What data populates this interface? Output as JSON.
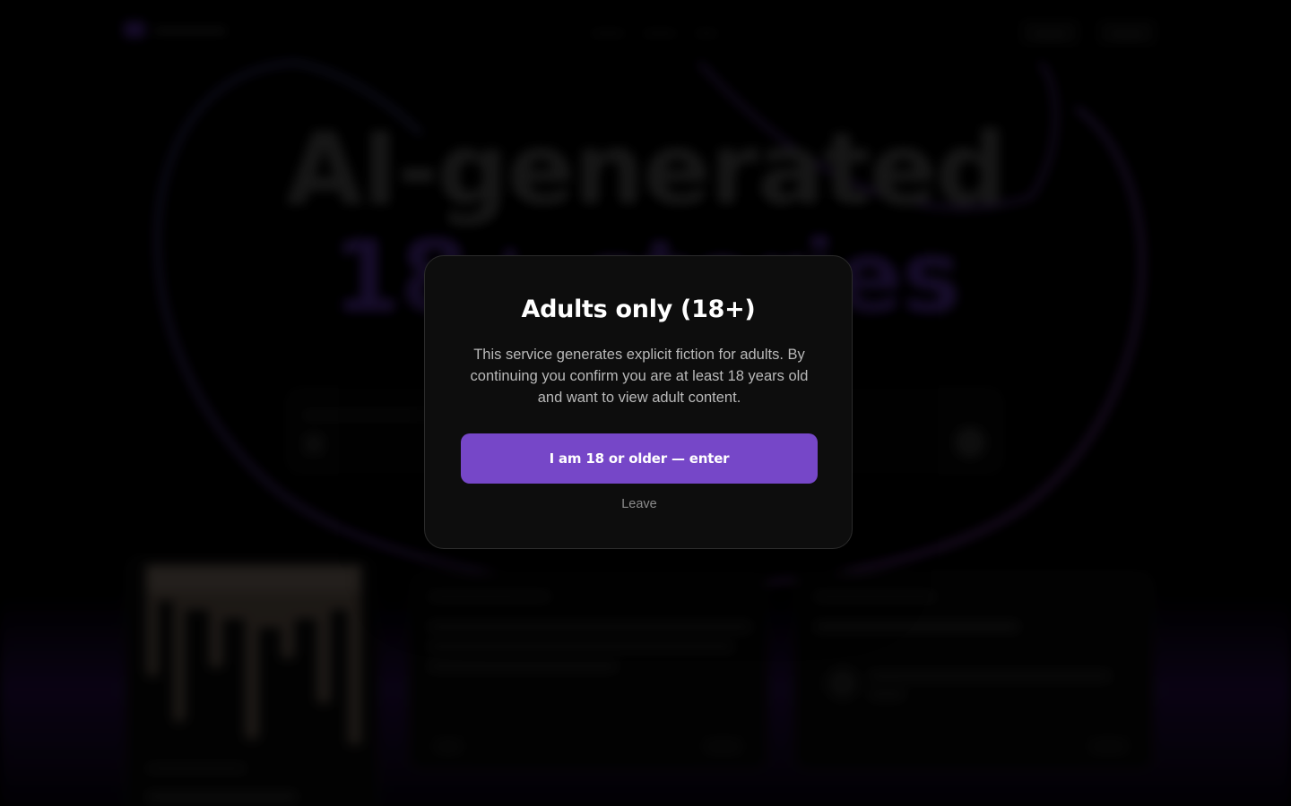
{
  "background": {
    "hero_title_line1": "AI-generated",
    "hero_title_line2": "18+ stories"
  },
  "modal": {
    "title": "Adults only (18+)",
    "body": "This service generates explicit fiction for adults. By continuing you confirm you are at least 18 years old and want to view adult content.",
    "enter_label": "I am 18 or older — enter",
    "leave_label": "Leave"
  },
  "colors": {
    "accent": "#7647c8",
    "modal_background": "#0d0d0d",
    "page_background": "#000000"
  }
}
